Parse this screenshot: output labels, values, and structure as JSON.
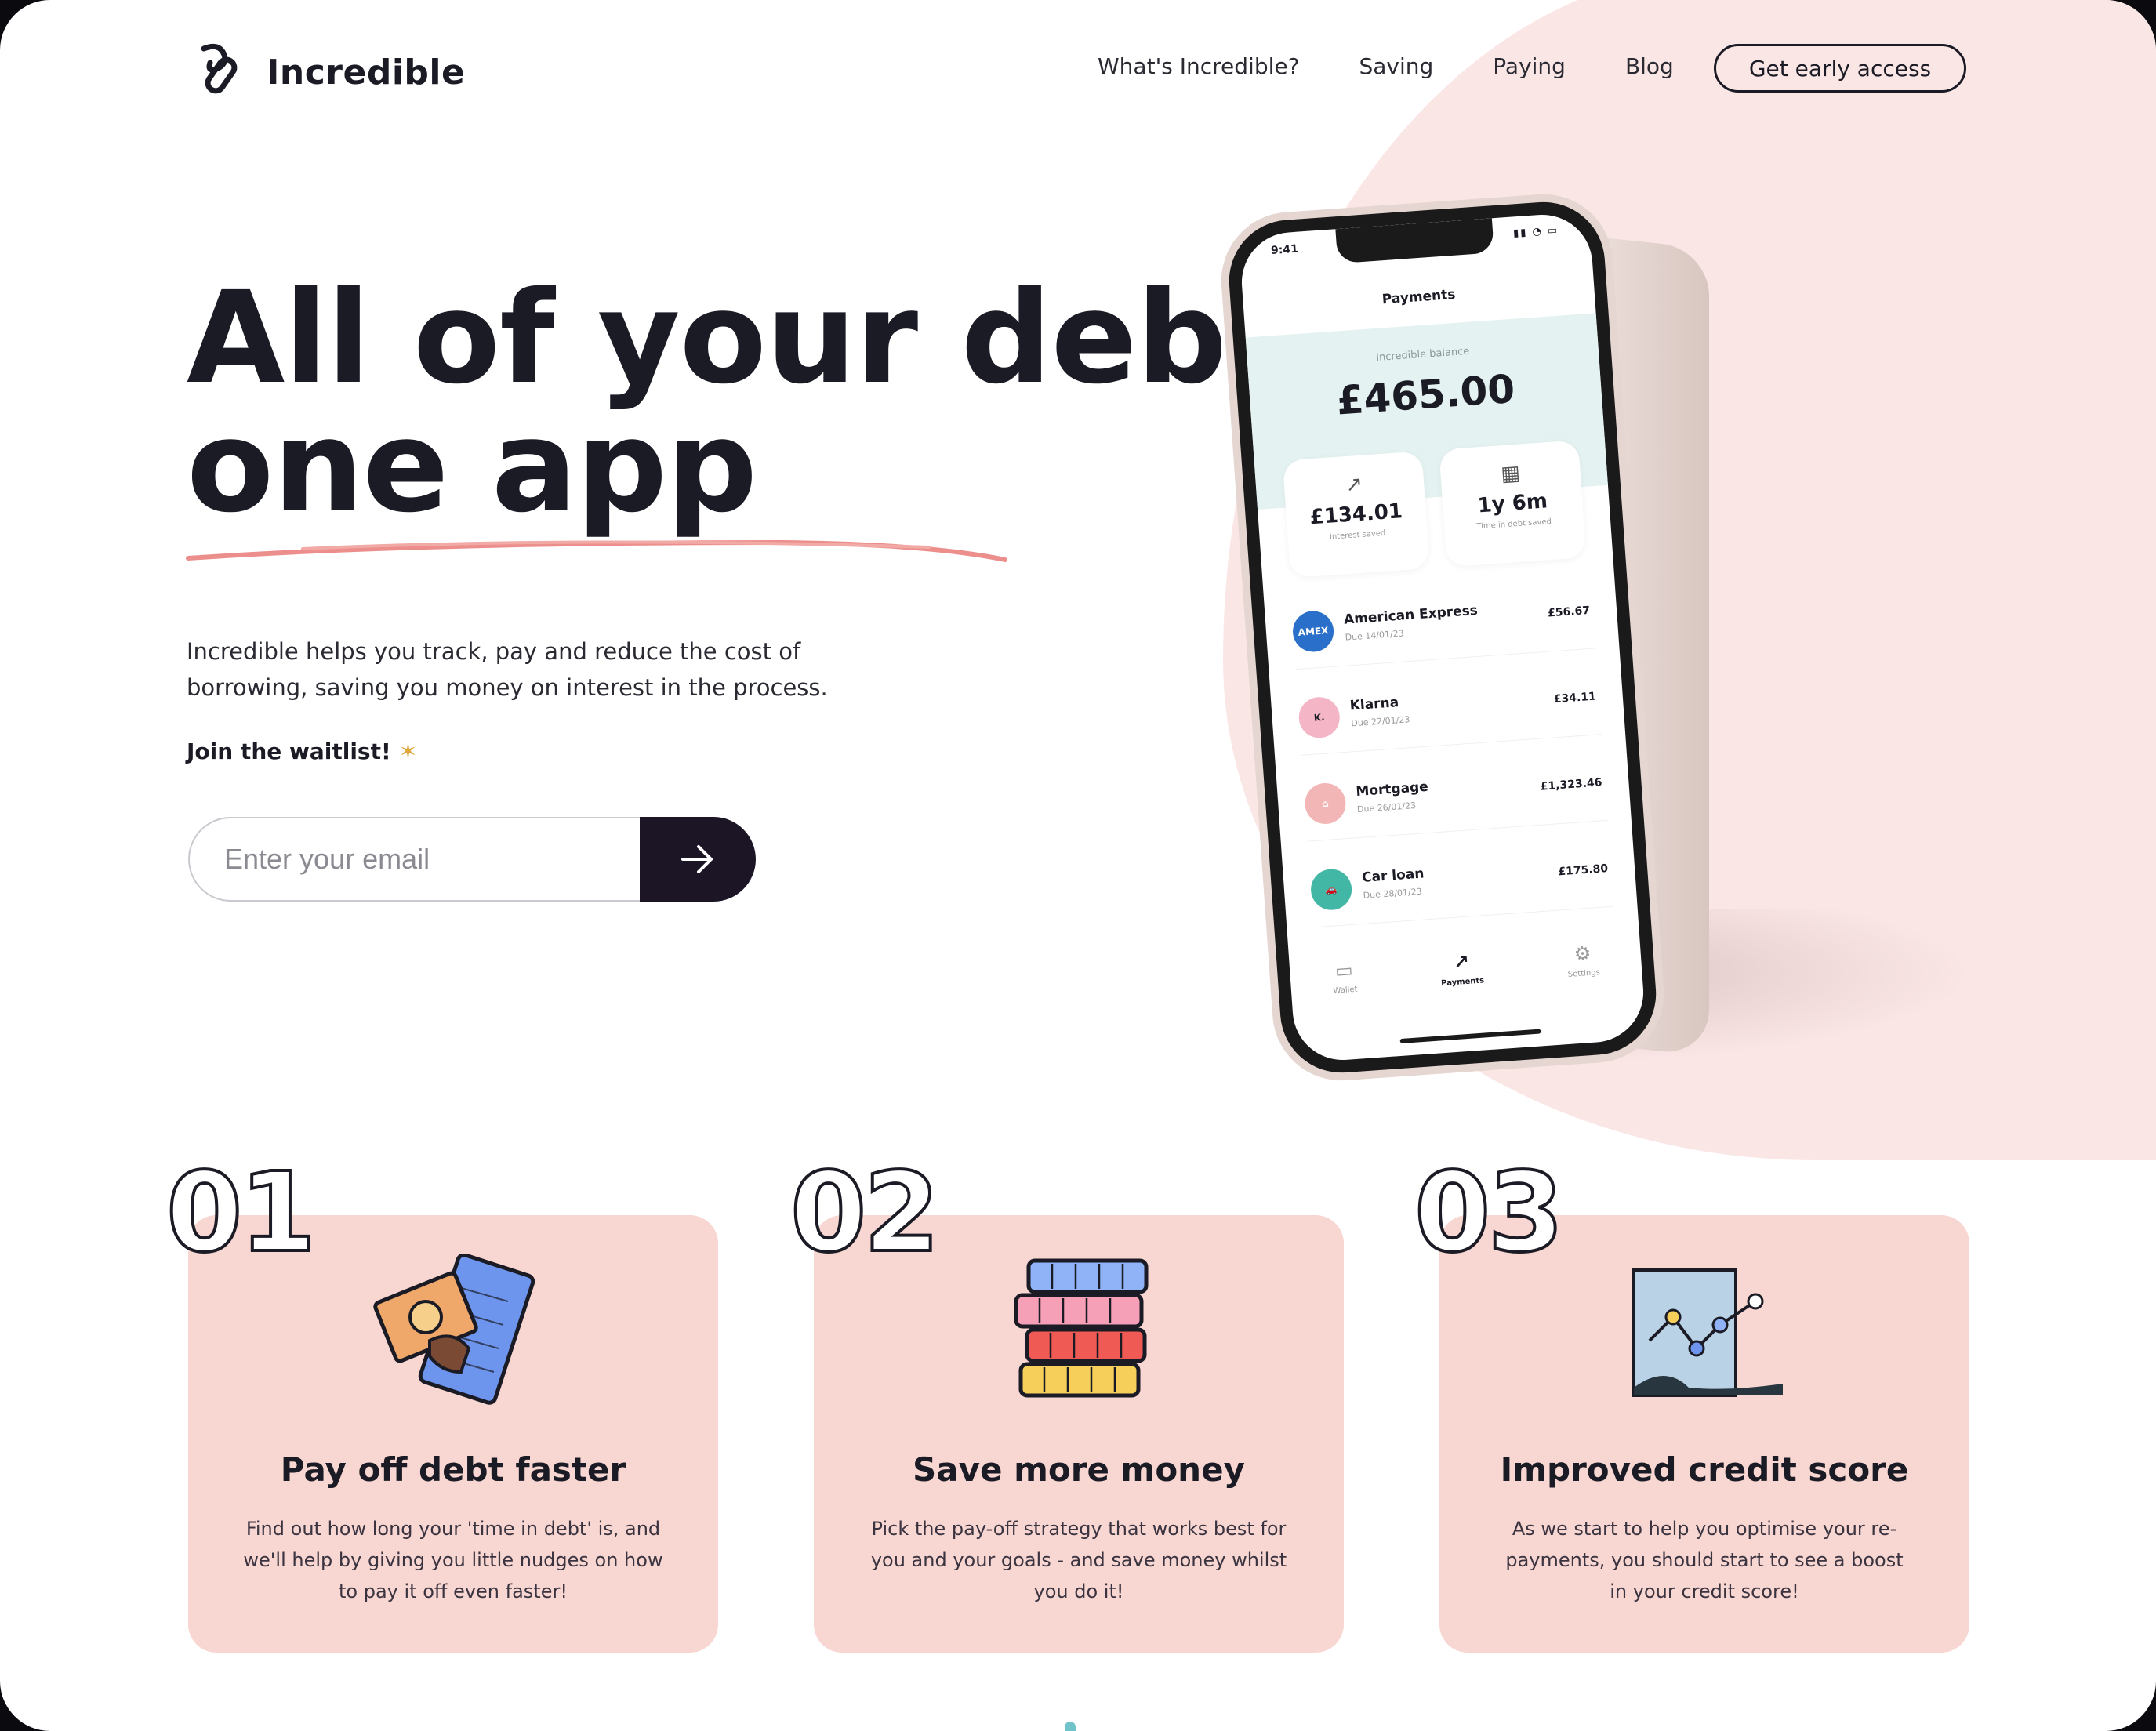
{
  "brand": {
    "name": "Incredible"
  },
  "nav": {
    "items": [
      "What's Incredible?",
      "Saving",
      "Paying",
      "Blog"
    ],
    "cta": "Get early access"
  },
  "hero": {
    "title_line1": "All of your debt,",
    "title_line2": "one app",
    "description": "Incredible helps you track, pay and reduce the cost of borrowing, saving you money on interest in the process.",
    "waitlist_label": "Join the waitlist!",
    "email_placeholder": "Enter your email"
  },
  "phone": {
    "time": "9:41",
    "title": "Payments",
    "balance_label": "Incredible balance",
    "balance": "£465.00",
    "stats": [
      {
        "value": "£134.01",
        "caption": "Interest saved"
      },
      {
        "value": "1y 6m",
        "caption": "Time in debt saved"
      }
    ],
    "payments": [
      {
        "name": "American Express",
        "due": "Due 14/01/23",
        "amount": "£56.67",
        "logo": "AMEX",
        "color": "#2a6fc9"
      },
      {
        "name": "Klarna",
        "due": "Due 22/01/23",
        "amount": "£34.11",
        "logo": "K.",
        "color": "#f4b6c7"
      },
      {
        "name": "Mortgage",
        "due": "Due 26/01/23",
        "amount": "£1,323.46",
        "logo": "⌂",
        "color": "#f3b6b6"
      },
      {
        "name": "Car loan",
        "due": "Due 28/01/23",
        "amount": "£175.80",
        "logo": "🚗",
        "color": "#43b7a5"
      }
    ],
    "tabs": [
      "Wallet",
      "Payments",
      "Settings"
    ]
  },
  "features": [
    {
      "number": "01",
      "title": "Pay off debt faster",
      "description": "Find out how long your 'time in debt' is, and we'll help by giving you little nudges on how to pay it off even faster!",
      "icon": "money-calculator-icon"
    },
    {
      "number": "02",
      "title": "Save more money",
      "description": "Pick the pay-off strategy that works best for you and your goals - and save money whilst you do it!",
      "icon": "coin-stack-icon"
    },
    {
      "number": "03",
      "title": "Improved credit score",
      "description": "As we start to help you optimise your re-payments, you should start to see a boost in your credit score!",
      "icon": "growth-chart-icon"
    }
  ],
  "colors": {
    "ink": "#1b1b25",
    "pink_bg": "#fbe6e6",
    "card_pink": "#f8d6d1",
    "accent_underline": "#ec8f8c",
    "button_dark": "#1c1526"
  }
}
